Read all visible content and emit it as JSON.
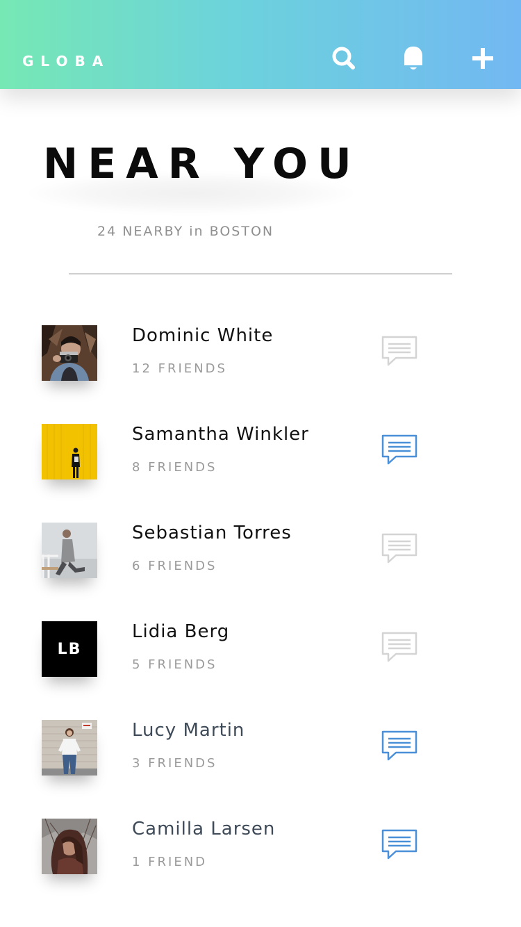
{
  "header": {
    "brand": "GLOBA",
    "actions": [
      {
        "name": "search",
        "icon": "search-icon"
      },
      {
        "name": "notifications",
        "icon": "bell-icon"
      },
      {
        "name": "add",
        "icon": "plus-icon"
      }
    ]
  },
  "page": {
    "title": "NEAR YOU",
    "subtitle": "24 NEARBY in BOSTON"
  },
  "colors": {
    "header_gradient_start": "#76e8b4",
    "header_gradient_end": "#72b8f2",
    "message_active": "#4a90d9",
    "message_inactive": "#d4d4d4"
  },
  "users": [
    {
      "name": "Dominic White",
      "friends": "12 FRIENDS",
      "avatar": "photo",
      "message_active": false
    },
    {
      "name": "Samantha Winkler",
      "friends": "8 FRIENDS",
      "avatar": "photo",
      "message_active": true
    },
    {
      "name": "Sebastian Torres",
      "friends": "6 FRIENDS",
      "avatar": "photo",
      "message_active": false
    },
    {
      "name": "Lidia Berg",
      "friends": "5 FRIENDS",
      "avatar": "initials",
      "initials": "LB",
      "message_active": false
    },
    {
      "name": "Lucy Martin",
      "friends": "3 FRIENDS",
      "avatar": "photo",
      "message_active": true
    },
    {
      "name": "Camilla Larsen",
      "friends": "1 FRIEND",
      "avatar": "photo",
      "message_active": true
    }
  ]
}
